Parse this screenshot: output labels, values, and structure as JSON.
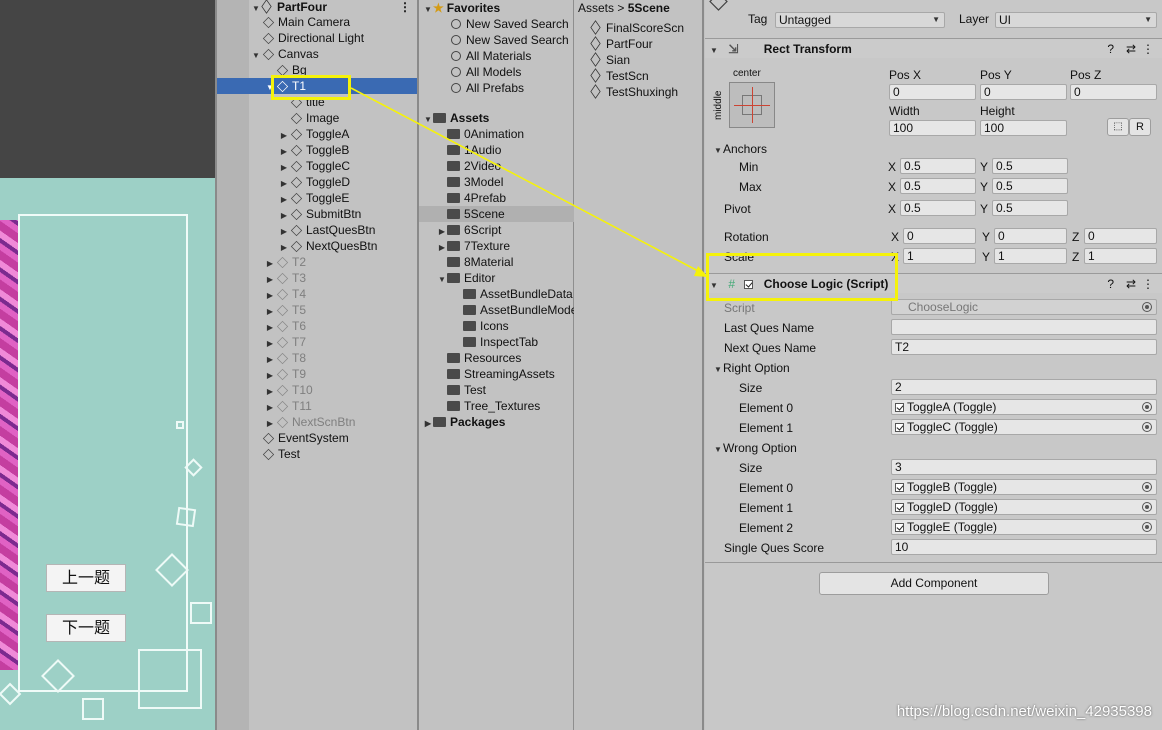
{
  "game_view": {
    "prev_button": "上一题",
    "next_button": "下一题"
  },
  "hierarchy": {
    "scene_name": "PartFour",
    "items": [
      {
        "label": "Main Camera",
        "depth": 1,
        "expand": "",
        "dim": false,
        "sel": false
      },
      {
        "label": "Directional Light",
        "depth": 1,
        "expand": "",
        "dim": false,
        "sel": false
      },
      {
        "label": "Canvas",
        "depth": 1,
        "expand": "open",
        "dim": false,
        "sel": false
      },
      {
        "label": "Bg",
        "depth": 2,
        "expand": "",
        "dim": false,
        "sel": false
      },
      {
        "label": "T1",
        "depth": 2,
        "expand": "open",
        "dim": false,
        "sel": true
      },
      {
        "label": "title",
        "depth": 3,
        "expand": "",
        "dim": false,
        "sel": false
      },
      {
        "label": "Image",
        "depth": 3,
        "expand": "",
        "dim": false,
        "sel": false
      },
      {
        "label": "ToggleA",
        "depth": 3,
        "expand": "closed",
        "dim": false,
        "sel": false
      },
      {
        "label": "ToggleB",
        "depth": 3,
        "expand": "closed",
        "dim": false,
        "sel": false
      },
      {
        "label": "ToggleC",
        "depth": 3,
        "expand": "closed",
        "dim": false,
        "sel": false
      },
      {
        "label": "ToggleD",
        "depth": 3,
        "expand": "closed",
        "dim": false,
        "sel": false
      },
      {
        "label": "ToggleE",
        "depth": 3,
        "expand": "closed",
        "dim": false,
        "sel": false
      },
      {
        "label": "SubmitBtn",
        "depth": 3,
        "expand": "closed",
        "dim": false,
        "sel": false
      },
      {
        "label": "LastQuesBtn",
        "depth": 3,
        "expand": "closed",
        "dim": false,
        "sel": false
      },
      {
        "label": "NextQuesBtn",
        "depth": 3,
        "expand": "closed",
        "dim": false,
        "sel": false
      },
      {
        "label": "T2",
        "depth": 2,
        "expand": "closed",
        "dim": true,
        "sel": false
      },
      {
        "label": "T3",
        "depth": 2,
        "expand": "closed",
        "dim": true,
        "sel": false
      },
      {
        "label": "T4",
        "depth": 2,
        "expand": "closed",
        "dim": true,
        "sel": false
      },
      {
        "label": "T5",
        "depth": 2,
        "expand": "closed",
        "dim": true,
        "sel": false
      },
      {
        "label": "T6",
        "depth": 2,
        "expand": "closed",
        "dim": true,
        "sel": false
      },
      {
        "label": "T7",
        "depth": 2,
        "expand": "closed",
        "dim": true,
        "sel": false
      },
      {
        "label": "T8",
        "depth": 2,
        "expand": "closed",
        "dim": true,
        "sel": false
      },
      {
        "label": "T9",
        "depth": 2,
        "expand": "closed",
        "dim": true,
        "sel": false
      },
      {
        "label": "T10",
        "depth": 2,
        "expand": "closed",
        "dim": true,
        "sel": false
      },
      {
        "label": "T11",
        "depth": 2,
        "expand": "closed",
        "dim": true,
        "sel": false
      },
      {
        "label": "NextScnBtn",
        "depth": 2,
        "expand": "closed",
        "dim": true,
        "sel": false
      },
      {
        "label": "EventSystem",
        "depth": 1,
        "expand": "",
        "dim": false,
        "sel": false
      },
      {
        "label": "Test",
        "depth": 1,
        "expand": "",
        "dim": false,
        "sel": false
      }
    ]
  },
  "project": {
    "favorites_label": "Favorites",
    "favorites": [
      "New Saved Search",
      "New Saved Search",
      "All Materials",
      "All Models",
      "All Prefabs"
    ],
    "assets_label": "Assets",
    "assets": [
      {
        "label": "0Animation",
        "depth": 1,
        "expand": ""
      },
      {
        "label": "1Audio",
        "depth": 1,
        "expand": ""
      },
      {
        "label": "2Video",
        "depth": 1,
        "expand": ""
      },
      {
        "label": "3Model",
        "depth": 1,
        "expand": ""
      },
      {
        "label": "4Prefab",
        "depth": 1,
        "expand": ""
      },
      {
        "label": "5Scene",
        "depth": 1,
        "expand": "",
        "sel": true
      },
      {
        "label": "6Script",
        "depth": 1,
        "expand": "closed"
      },
      {
        "label": "7Texture",
        "depth": 1,
        "expand": "closed"
      },
      {
        "label": "8Material",
        "depth": 1,
        "expand": ""
      },
      {
        "label": "Editor",
        "depth": 1,
        "expand": "open"
      },
      {
        "label": "AssetBundleData",
        "depth": 2,
        "expand": ""
      },
      {
        "label": "AssetBundleModel",
        "depth": 2,
        "expand": ""
      },
      {
        "label": "Icons",
        "depth": 2,
        "expand": ""
      },
      {
        "label": "InspectTab",
        "depth": 2,
        "expand": ""
      },
      {
        "label": "Resources",
        "depth": 1,
        "expand": ""
      },
      {
        "label": "StreamingAssets",
        "depth": 1,
        "expand": ""
      },
      {
        "label": "Test",
        "depth": 1,
        "expand": ""
      },
      {
        "label": "Tree_Textures",
        "depth": 1,
        "expand": ""
      }
    ],
    "packages_label": "Packages",
    "breadcrumb_root": "Assets",
    "breadcrumb_sep": ">",
    "breadcrumb_current": "5Scene",
    "files": [
      "FinalScoreScn",
      "PartFour",
      "Sian",
      "TestScn",
      "TestShuxingh"
    ]
  },
  "inspector": {
    "tag_label": "Tag",
    "tag_value": "Untagged",
    "layer_label": "Layer",
    "layer_value": "UI",
    "rect_title": "Rect Transform",
    "anchor_preset_top": "center",
    "anchor_preset_side": "middle",
    "pos_x_label": "Pos X",
    "pos_x": "0",
    "pos_y_label": "Pos Y",
    "pos_y": "0",
    "pos_z_label": "Pos Z",
    "pos_z": "0",
    "width_label": "Width",
    "width": "100",
    "height_label": "Height",
    "height": "100",
    "r_button": "R",
    "anchors_label": "Anchors",
    "min_label": "Min",
    "min_x": "0.5",
    "min_y": "0.5",
    "max_label": "Max",
    "max_x": "0.5",
    "max_y": "0.5",
    "pivot_label": "Pivot",
    "pivot_x": "0.5",
    "pivot_y": "0.5",
    "rotation_label": "Rotation",
    "rot_x": "0",
    "rot_y": "0",
    "rot_z": "0",
    "scale_label": "Scale",
    "scale_x": "1",
    "scale_y": "1",
    "scale_z": "1",
    "x": "X",
    "y": "Y",
    "z": "Z",
    "script_title": "Choose Logic (Script)",
    "script_label": "Script",
    "script_value": "ChooseLogic",
    "last_ques_label": "Last Ques Name",
    "last_ques_value": "",
    "next_ques_label": "Next Ques Name",
    "next_ques_value": "T2",
    "right_option_label": "Right Option",
    "right_size_label": "Size",
    "right_size": "2",
    "right_elements": [
      {
        "label": "Element 0",
        "value": "ToggleA (Toggle)"
      },
      {
        "label": "Element 1",
        "value": "ToggleC (Toggle)"
      }
    ],
    "wrong_option_label": "Wrong Option",
    "wrong_size_label": "Size",
    "wrong_size": "3",
    "wrong_elements": [
      {
        "label": "Element 0",
        "value": "ToggleB (Toggle)"
      },
      {
        "label": "Element 1",
        "value": "ToggleD (Toggle)"
      },
      {
        "label": "Element 2",
        "value": "ToggleE (Toggle)"
      }
    ],
    "score_label": "Single Ques Score",
    "score_value": "10",
    "add_component": "Add Component"
  },
  "watermark": "https://blog.csdn.net/weixin_42935398",
  "colors": {
    "highlight": "#f5f20a",
    "selection": "#3a6ab3",
    "game_bg": "#9dd0c6"
  }
}
